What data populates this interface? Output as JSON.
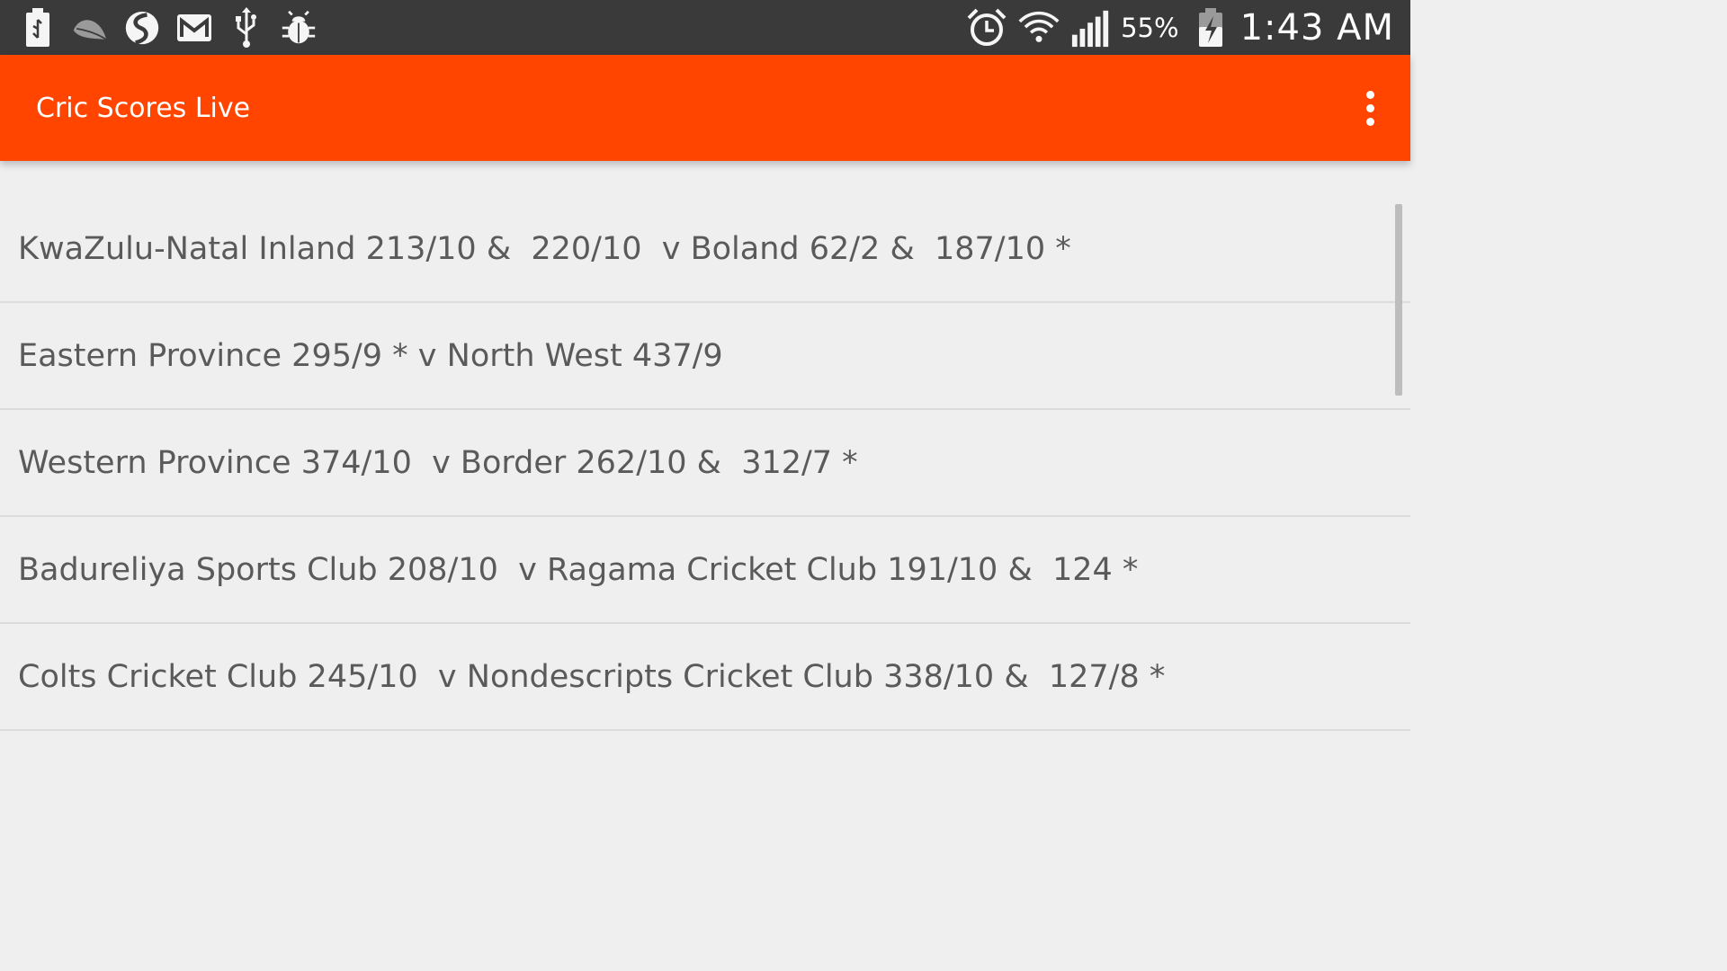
{
  "status_bar": {
    "left_icons": [
      "usb-battery-icon",
      "leaf-icon",
      "swype-icon",
      "gmail-icon",
      "usb-icon",
      "debug-bug-icon"
    ],
    "right_icons": [
      "alarm-icon",
      "wifi-icon",
      "signal-icon",
      "battery-charging-icon"
    ],
    "battery_percent": "55%",
    "time": "1:43 AM"
  },
  "action_bar": {
    "title": "Cric Scores Live",
    "overflow_menu": "overflow-menu-icon"
  },
  "matches": [
    "KwaZulu-Natal Inland 213/10 &  220/10  v Boland 62/2 &  187/10 *",
    "Eastern Province 295/9 * v North West 437/9",
    "Western Province 374/10  v Border 262/10 &  312/7 *",
    "Badureliya Sports Club 208/10  v Ragama Cricket Club 191/10 &  124 *",
    "Colts Cricket Club 245/10  v Nondescripts Cricket Club 338/10 &  127/8 *"
  ],
  "colors": {
    "accent": "#ff4500",
    "status_bar": "#3a3a3a",
    "background": "#efefef",
    "text": "#5a5a5a"
  }
}
